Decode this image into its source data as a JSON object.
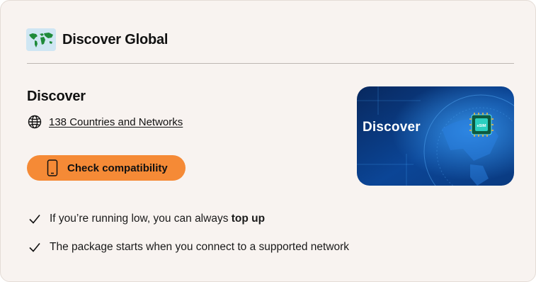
{
  "header": {
    "title": "Discover Global",
    "icon": "world-map-icon"
  },
  "plan": {
    "name": "Discover",
    "coverage_link": "138 Countries and Networks",
    "coverage_icon": "globe-icon"
  },
  "compatibility_button": {
    "label": "Check compatibility",
    "icon": "smartphone-icon"
  },
  "esim_image": {
    "title": "Discover",
    "chip_label": "eSIM"
  },
  "features": [
    {
      "text": "If you’re running low, you can always ",
      "bold": "top up"
    },
    {
      "text": "The package starts when you connect to a supported network",
      "bold": ""
    }
  ],
  "colors": {
    "card_background": "#f8f3f0",
    "accent": "#f58a36",
    "divider": "#bdb7b2",
    "image_blue": "#0b3f86"
  }
}
